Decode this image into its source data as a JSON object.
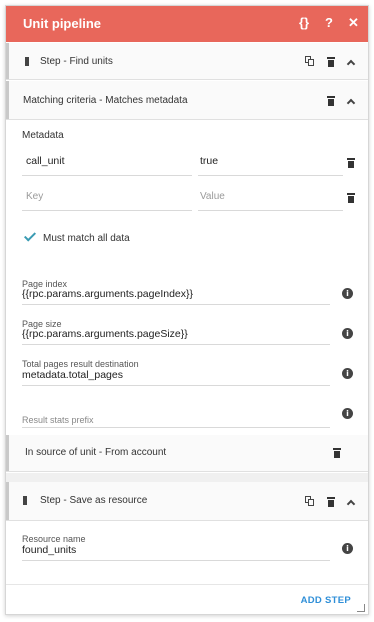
{
  "header": {
    "title": "Unit pipeline",
    "json_icon": "{}",
    "help_icon": "?",
    "close_icon": "✕",
    "bg_color": "#e8675b"
  },
  "steps": [
    {
      "label": "Step - Find units",
      "criteria": {
        "label": "Matching criteria - Matches metadata",
        "metadata_label": "Metadata",
        "rows": [
          {
            "key": "call_unit",
            "value": "true"
          }
        ],
        "new_row": {
          "key_placeholder": "Key",
          "value_placeholder": "Value"
        },
        "must_match_label": "Must match all data"
      },
      "fields": [
        {
          "label": "Page index",
          "value": "{{rpc.params.arguments.pageIndex}}"
        },
        {
          "label": "Page size",
          "value": "{{rpc.params.arguments.pageSize}}"
        },
        {
          "label": "Total pages result destination",
          "value": "metadata.total_pages"
        },
        {
          "label": "Result stats prefix",
          "value": ""
        }
      ],
      "source": {
        "label": "In source of unit - From account"
      }
    },
    {
      "label": "Step - Save as resource",
      "fields": [
        {
          "label": "Resource name",
          "value": "found_units"
        }
      ]
    }
  ],
  "footer": {
    "add_step_label": "ADD STEP",
    "accent": "#2f8fd8"
  }
}
